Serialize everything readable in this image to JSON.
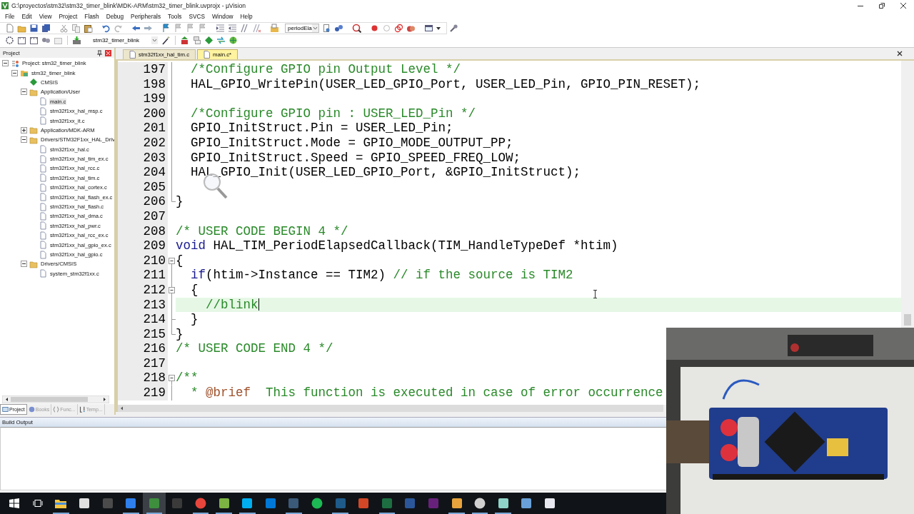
{
  "window": {
    "title": "G:\\proyectos\\stm32\\stm32_timer_blink\\MDK-ARM\\stm32_timer_blink.uvprojx - µVision"
  },
  "menu": [
    "File",
    "Edit",
    "View",
    "Project",
    "Flash",
    "Debug",
    "Peripherals",
    "Tools",
    "SVCS",
    "Window",
    "Help"
  ],
  "toolbar": {
    "find_box": "periodEla",
    "target": "stm32_timer_blink"
  },
  "project_panel": {
    "title": "Project",
    "tree": [
      {
        "label": "Project: stm32_timer_blink",
        "kind": "project",
        "expanded": true,
        "selected": false,
        "children": [
          {
            "label": "stm32_timer_blink",
            "kind": "target",
            "expanded": true,
            "selected": false,
            "children": [
              {
                "label": "CMSIS",
                "kind": "component",
                "selected": false
              },
              {
                "label": "Application/User",
                "kind": "folder",
                "expanded": true,
                "selected": false,
                "children": [
                  {
                    "label": "main.c",
                    "kind": "file",
                    "selected": true
                  },
                  {
                    "label": "stm32f1xx_hal_msp.c",
                    "kind": "file",
                    "selected": false
                  },
                  {
                    "label": "stm32f1xx_it.c",
                    "kind": "file",
                    "selected": false
                  }
                ]
              },
              {
                "label": "Application/MDK-ARM",
                "kind": "folder",
                "expanded": false,
                "selected": false
              },
              {
                "label": "Drivers/STM32F1xx_HAL_Driv",
                "kind": "folder",
                "expanded": true,
                "selected": false,
                "children": [
                  {
                    "label": "stm32f1xx_hal.c",
                    "kind": "file",
                    "selected": false
                  },
                  {
                    "label": "stm32f1xx_hal_tim_ex.c",
                    "kind": "file",
                    "selected": false
                  },
                  {
                    "label": "stm32f1xx_hal_rcc.c",
                    "kind": "file",
                    "selected": false
                  },
                  {
                    "label": "stm32f1xx_hal_tim.c",
                    "kind": "file",
                    "selected": false
                  },
                  {
                    "label": "stm32f1xx_hal_cortex.c",
                    "kind": "file",
                    "selected": false
                  },
                  {
                    "label": "stm32f1xx_hal_flash_ex.c",
                    "kind": "file",
                    "selected": false
                  },
                  {
                    "label": "stm32f1xx_hal_flash.c",
                    "kind": "file",
                    "selected": false
                  },
                  {
                    "label": "stm32f1xx_hal_dma.c",
                    "kind": "file",
                    "selected": false
                  },
                  {
                    "label": "stm32f1xx_hal_pwr.c",
                    "kind": "file",
                    "selected": false
                  },
                  {
                    "label": "stm32f1xx_hal_rcc_ex.c",
                    "kind": "file",
                    "selected": false
                  },
                  {
                    "label": "stm32f1xx_hal_gpio_ex.c",
                    "kind": "file",
                    "selected": false
                  },
                  {
                    "label": "stm32f1xx_hal_gpio.c",
                    "kind": "file",
                    "selected": false
                  }
                ]
              },
              {
                "label": "Drivers/CMSIS",
                "kind": "folder",
                "expanded": true,
                "selected": false,
                "children": [
                  {
                    "label": "system_stm32f1xx.c",
                    "kind": "file",
                    "selected": false
                  }
                ]
              }
            ]
          }
        ]
      }
    ],
    "tabs": [
      {
        "label": "Project",
        "selected": true
      },
      {
        "label": "Books",
        "selected": false
      },
      {
        "label": "Func...",
        "selected": false
      },
      {
        "label": "Temp...",
        "selected": false
      }
    ]
  },
  "editor": {
    "tabs": [
      {
        "label": "stm32f1xx_hal_tim.c",
        "selected": false
      },
      {
        "label": "main.c*",
        "selected": true
      }
    ],
    "lines": [
      {
        "number": "197",
        "kind": "line",
        "current": false,
        "tokens": [
          {
            "kind": "comment",
            "text": "  /*Configure GPIO pin Output Level */"
          }
        ]
      },
      {
        "number": "198",
        "kind": "line",
        "current": false,
        "tokens": [
          {
            "kind": "code",
            "text": "  HAL_GPIO_WritePin(USER_LED_GPIO_Port, USER_LED_Pin, GPIO_PIN_RESET);"
          }
        ]
      },
      {
        "number": "199",
        "kind": "line",
        "current": false
      },
      {
        "number": "200",
        "kind": "line",
        "current": false,
        "tokens": [
          {
            "kind": "comment",
            "text": "  /*Configure GPIO pin : USER_LED_Pin */"
          }
        ]
      },
      {
        "number": "201",
        "kind": "line",
        "current": false,
        "tokens": [
          {
            "kind": "code",
            "text": "  GPIO_InitStruct.Pin = USER_LED_Pin;"
          }
        ]
      },
      {
        "number": "202",
        "kind": "line",
        "current": false,
        "tokens": [
          {
            "kind": "code",
            "text": "  GPIO_InitStruct.Mode = GPIO_MODE_OUTPUT_PP;"
          }
        ]
      },
      {
        "number": "203",
        "kind": "line",
        "current": false,
        "tokens": [
          {
            "kind": "code",
            "text": "  GPIO_InitStruct.Speed = GPIO_SPEED_FREQ_LOW;"
          }
        ]
      },
      {
        "number": "204",
        "kind": "line",
        "current": false,
        "tokens": [
          {
            "kind": "code",
            "text": "  HAL_GPIO_Init(USER_LED_GPIO_Port, &GPIO_InitStruct);"
          }
        ]
      },
      {
        "number": "205",
        "kind": "line",
        "current": false
      },
      {
        "number": "206",
        "kind": "fold_end",
        "current": false,
        "tokens": [
          {
            "kind": "code",
            "text": "}"
          }
        ]
      },
      {
        "number": "207",
        "kind": "line",
        "current": false
      },
      {
        "number": "208",
        "kind": "line",
        "current": false,
        "tokens": [
          {
            "kind": "comment",
            "text": "/* USER CODE BEGIN 4 */"
          }
        ]
      },
      {
        "number": "209",
        "kind": "line",
        "current": false,
        "tokens": [
          {
            "kind": "keyword",
            "text": "void"
          },
          {
            "kind": "code",
            "text": " HAL_TIM_PeriodElapsedCallback(TIM_HandleTypeDef *htim)"
          }
        ]
      },
      {
        "number": "210",
        "kind": "fold_start",
        "current": false,
        "tokens": [
          {
            "kind": "code",
            "text": "{"
          }
        ]
      },
      {
        "number": "211",
        "kind": "line",
        "current": false,
        "tokens": [
          {
            "kind": "keyword",
            "text": "  if"
          },
          {
            "kind": "code",
            "text": "(htim->Instance == TIM2) "
          },
          {
            "kind": "comment",
            "text": "// if the source is TIM2"
          }
        ]
      },
      {
        "number": "212",
        "kind": "fold_start",
        "current": false,
        "tokens": [
          {
            "kind": "code",
            "text": "  {"
          }
        ]
      },
      {
        "number": "213",
        "kind": "line",
        "current": true,
        "tokens": [
          {
            "kind": "comment",
            "text": "    //blink"
          }
        ]
      },
      {
        "number": "214",
        "kind": "fold_end",
        "current": false,
        "tokens": [
          {
            "kind": "code",
            "text": "  }"
          }
        ]
      },
      {
        "number": "215",
        "kind": "fold_end",
        "current": false,
        "tokens": [
          {
            "kind": "code",
            "text": "}"
          }
        ]
      },
      {
        "number": "216",
        "kind": "line",
        "current": false,
        "tokens": [
          {
            "kind": "comment",
            "text": "/* USER CODE END 4 */"
          }
        ]
      },
      {
        "number": "217",
        "kind": "line",
        "current": false
      },
      {
        "number": "218",
        "kind": "fold_start",
        "current": false,
        "tokens": [
          {
            "kind": "comment",
            "text": "/**"
          }
        ]
      },
      {
        "number": "219",
        "kind": "line",
        "current": false,
        "tokens": [
          {
            "kind": "comment",
            "text": "  * "
          },
          {
            "kind": "doctag",
            "text": "@brief"
          },
          {
            "kind": "comment",
            "text": "  This function is executed in case of error occurrence"
          }
        ]
      }
    ]
  },
  "output": {
    "title": "Build Output"
  }
}
